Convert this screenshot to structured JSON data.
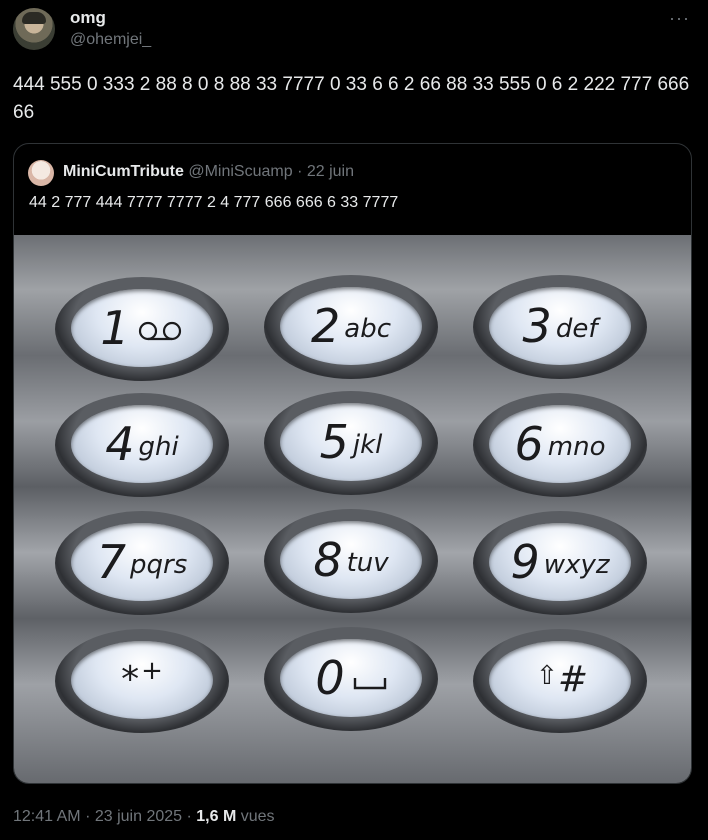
{
  "tweet": {
    "author_name": "omg",
    "author_handle": "@ohemjei_",
    "more_label": "···",
    "text": "444 555 0 333 2 88 8 0 8 88 33 7777 0 33 6 6 2 66 88 33 555 0 6 2 222 777 666 66"
  },
  "quote": {
    "author_name": "MiniCumTribute",
    "author_handle": "@MiniScuamp",
    "separator": "·",
    "date": "22 juin",
    "text": "44 2 777 444 7777 7777 2 4 777 666 666 6 33 7777"
  },
  "keypad": {
    "keys": [
      {
        "digit": "1",
        "letters": "○○"
      },
      {
        "digit": "2",
        "letters": "abc"
      },
      {
        "digit": "3",
        "letters": "def"
      },
      {
        "digit": "4",
        "letters": "ghi"
      },
      {
        "digit": "5",
        "letters": "jkl"
      },
      {
        "digit": "6",
        "letters": "mno"
      },
      {
        "digit": "7",
        "letters": "pqrs"
      },
      {
        "digit": "8",
        "letters": "tuv"
      },
      {
        "digit": "9",
        "letters": "wxyz"
      },
      {
        "digit": "*",
        "letters": "+"
      },
      {
        "digit": "0",
        "letters": "␣"
      },
      {
        "digit": "⇧",
        "letters": "#"
      }
    ]
  },
  "footer": {
    "time": "12:41 AM",
    "date": "23 juin 2025",
    "views_count": "1,6 M",
    "views_label": "vues"
  }
}
